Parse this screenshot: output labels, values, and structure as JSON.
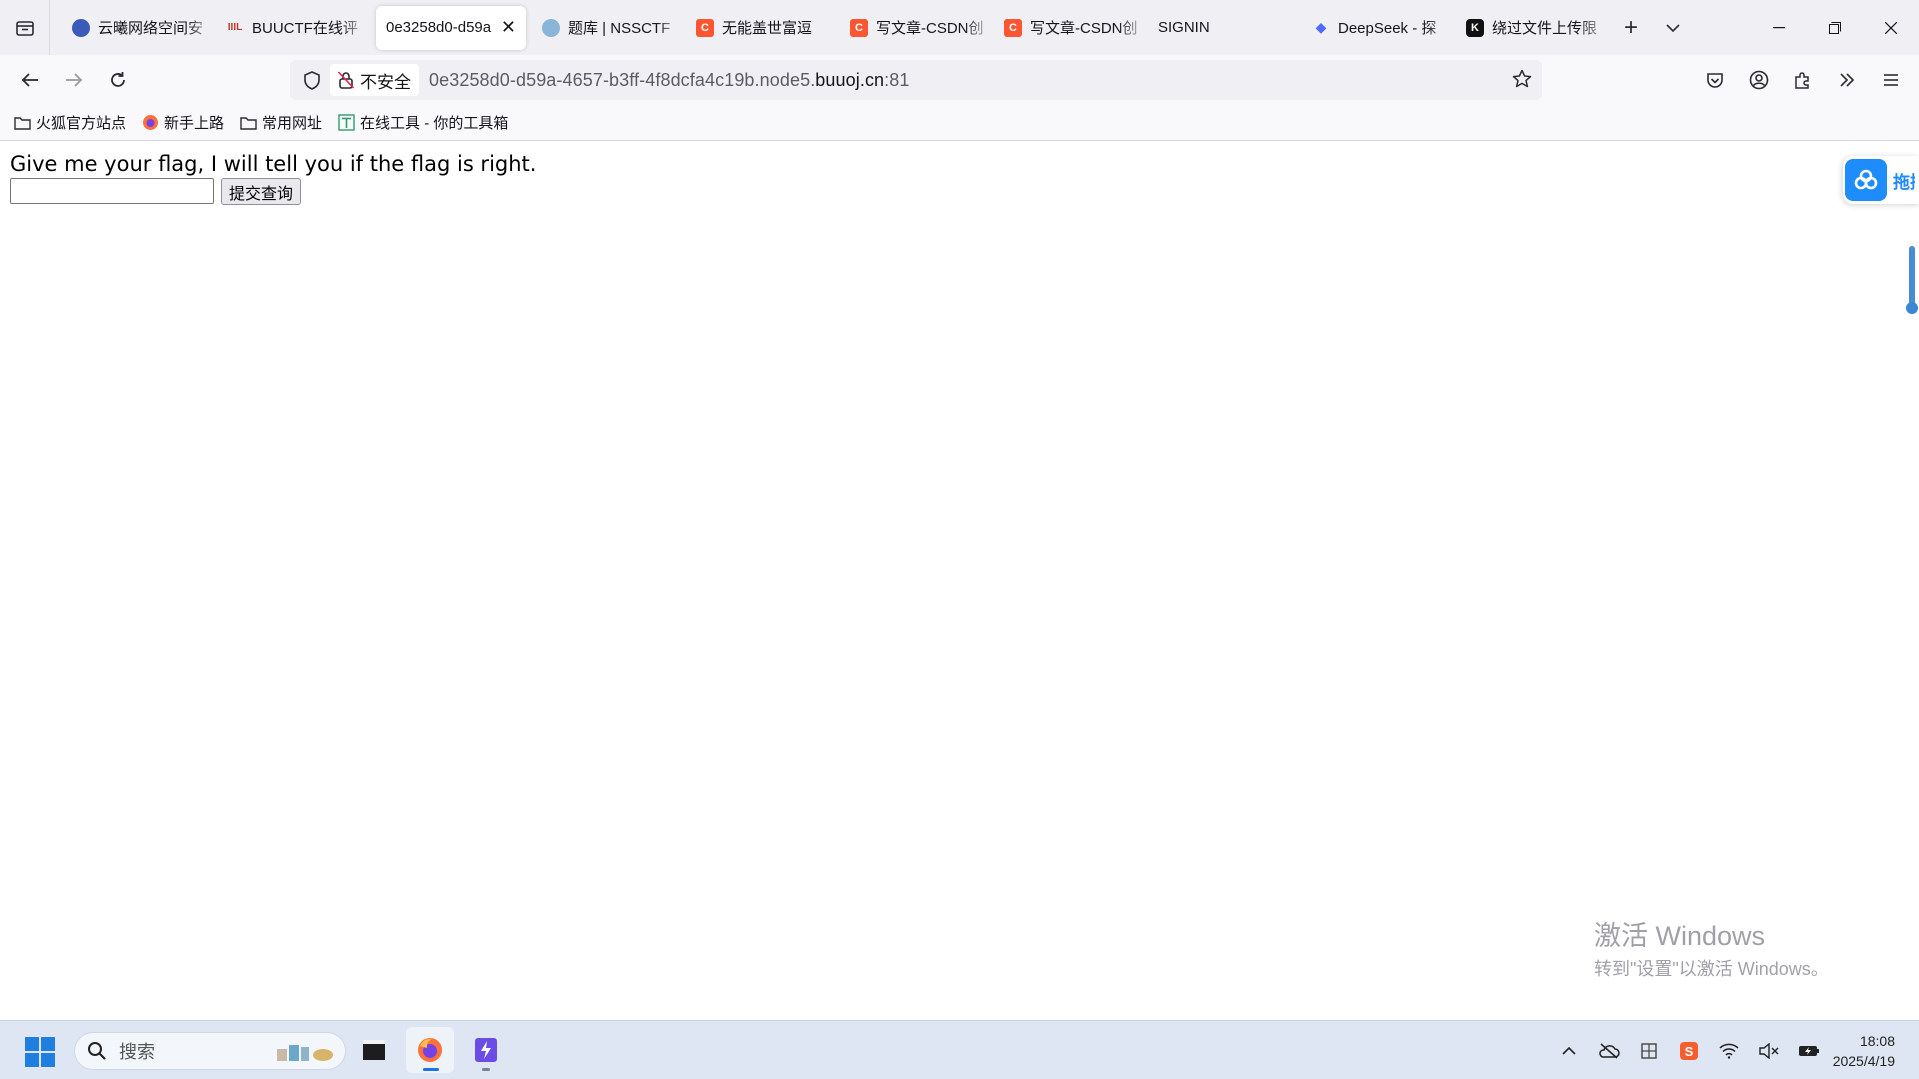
{
  "browser": {
    "tabs": [
      {
        "label": "云曦网络空间安",
        "favicon": "globe-icon",
        "active": false
      },
      {
        "label": "BUUCTF在线评",
        "favicon": "buuctf-icon",
        "active": false
      },
      {
        "label": "0e3258d0-d59a",
        "favicon": "",
        "active": true
      },
      {
        "label": "题库 | NSSCTF",
        "favicon": "nssctf-icon",
        "active": false
      },
      {
        "label": "无能盖世富逗",
        "favicon": "csdn-icon",
        "active": false
      },
      {
        "label": "写文章-CSDN创",
        "favicon": "csdn-icon",
        "active": false
      },
      {
        "label": "写文章-CSDN创",
        "favicon": "csdn-icon",
        "active": false
      },
      {
        "label": "SIGNIN",
        "favicon": "",
        "active": false
      },
      {
        "label": "DeepSeek - 探",
        "favicon": "deepseek-icon",
        "active": false
      },
      {
        "label": "绕过文件上传限",
        "favicon": "k-icon",
        "active": false
      }
    ],
    "security_label": "不安全",
    "url_prefix": "0e3258d0-d59a-4657-b3ff-4f8dcfa4c19b.node5.",
    "url_host": "buuoj.cn",
    "url_suffix": ":81",
    "bookmarks": [
      {
        "label": "火狐官方站点",
        "icon": "folder-icon"
      },
      {
        "label": "新手上路",
        "icon": "firefox-icon"
      },
      {
        "label": "常用网址",
        "icon": "folder-icon"
      },
      {
        "label": "在线工具 - 你的工具箱",
        "icon": "tool-icon"
      }
    ]
  },
  "page": {
    "prompt": "Give me your flag, I will tell you if the flag is right.",
    "input_value": "",
    "submit_label": "提交查询",
    "side_widget_label": "拖拽"
  },
  "watermark": {
    "line1": "激活 Windows",
    "line2": "转到\"设置\"以激活 Windows。"
  },
  "taskbar": {
    "search_label": "搜索",
    "time": "18:08",
    "date": "2025/4/19"
  },
  "colors": {
    "csdn": "#fc5531",
    "accent": "#1a73e8",
    "widget": "#1e8cfa"
  }
}
